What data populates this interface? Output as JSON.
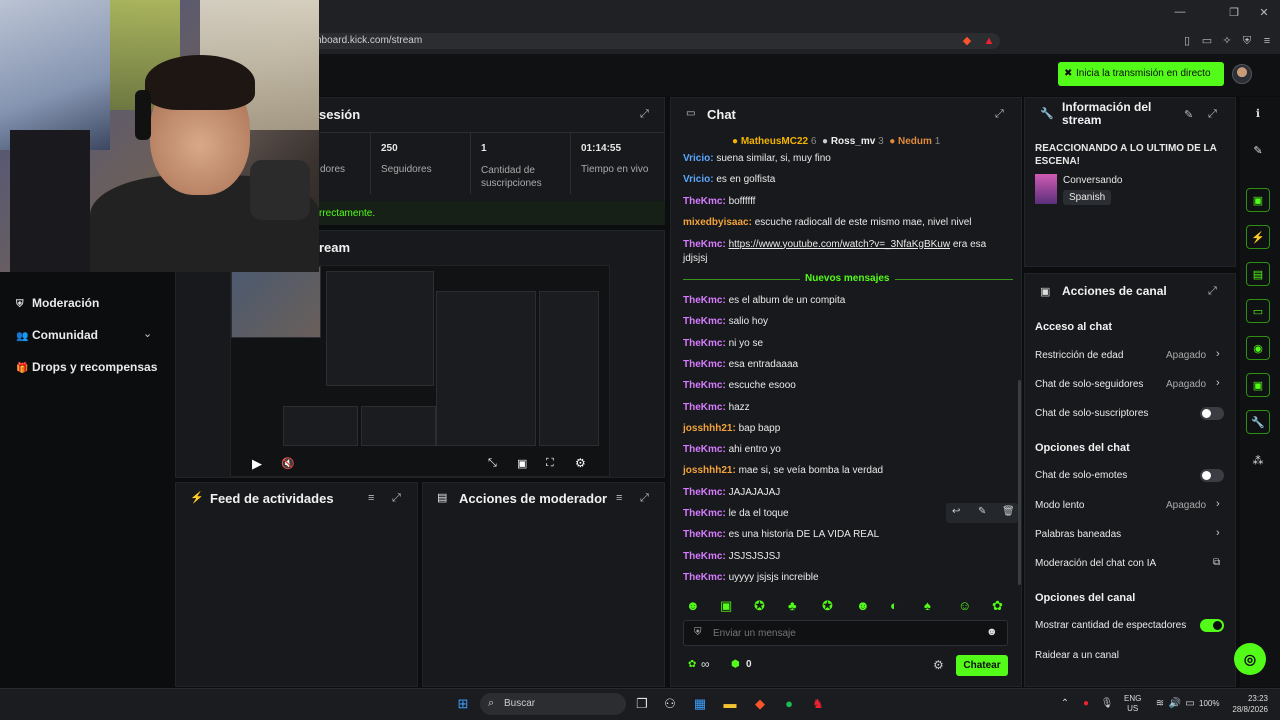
{
  "browser": {
    "url": "hboard.kick.com/stream",
    "window_controls": [
      "minimize-icon",
      "restore-icon",
      "close-icon"
    ]
  },
  "topbar": {
    "go_live_label": "Inicia la transmisión en directo"
  },
  "stats": {
    "title_fragment": "sesión",
    "items": [
      {
        "value": "",
        "label": "dores"
      },
      {
        "value": "250",
        "label": "Seguidores"
      },
      {
        "value": "1",
        "label": "Cantidad de suscripciones"
      },
      {
        "value": "01:14:55",
        "label": "Tiempo en vivo"
      }
    ],
    "status_text": "rrectamente."
  },
  "stream_section": {
    "title_fragment": "ream"
  },
  "sidebar": {
    "items": [
      {
        "label": "Moderación"
      },
      {
        "label": "Comunidad"
      },
      {
        "label": "Drops y recompensas"
      }
    ]
  },
  "feed": {
    "title": "Feed de actividades"
  },
  "modactions": {
    "title": "Acciones de moderador"
  },
  "chat": {
    "title": "Chat",
    "leaders": [
      {
        "name": "MatheusMC22",
        "count": "6"
      },
      {
        "name": "Ross_mv",
        "count": "3"
      },
      {
        "name": "Nedum",
        "count": "1"
      }
    ],
    "messages_before": [
      {
        "user": "Vricio",
        "text": "suena similar, si, muy fino",
        "color": "blue"
      },
      {
        "user": "Vricio",
        "text": "es en golfista",
        "color": "blue"
      },
      {
        "user": "TheKmc",
        "text": "boffffff",
        "color": "pink"
      },
      {
        "user": "mixedbyisaac",
        "text": "escuche radiocall de este mismo mae, nivel nivel",
        "color": "orange"
      },
      {
        "user": "TheKmc",
        "text": "https://www.youtube.com/watch?v=_3NfaKgBKuw",
        "text2": "era esa",
        "text3": "jdjsjsj",
        "color": "pink"
      }
    ],
    "new_divider": "Nuevos mensajes",
    "messages_after": [
      {
        "user": "TheKmc",
        "text": "es el album de un compita",
        "color": "pink"
      },
      {
        "user": "TheKmc",
        "text": "salio hoy",
        "color": "pink"
      },
      {
        "user": "TheKmc",
        "text": "ni yo se",
        "color": "pink"
      },
      {
        "user": "TheKmc",
        "text": "esa entradaaaa",
        "color": "pink"
      },
      {
        "user": "TheKmc",
        "text": "escuche esooo",
        "color": "pink"
      },
      {
        "user": "TheKmc",
        "text": "hazz",
        "color": "pink"
      },
      {
        "user": "josshhh21",
        "text": "bap bapp",
        "color": "orange"
      },
      {
        "user": "TheKmc",
        "text": "ahi entro yo",
        "color": "pink"
      },
      {
        "user": "josshhh21",
        "text": "mae si, se veía bomba la verdad",
        "color": "orange"
      },
      {
        "user": "TheKmc",
        "text": "JAJAJAJAJ",
        "color": "pink"
      },
      {
        "user": "TheKmc",
        "text": "le da el toque",
        "color": "pink"
      },
      {
        "user": "TheKmc",
        "text": "es una historia DE LA VIDA REAL",
        "color": "pink"
      },
      {
        "user": "TheKmc",
        "text": "JSJSJSJSJ",
        "color": "pink"
      },
      {
        "user": "TheKmc",
        "text": "uyyyy jsjsjs increible",
        "color": "pink"
      }
    ],
    "input_placeholder": "Enviar un mensaje",
    "infinite_label": "∞",
    "points_value": "0",
    "send_label": "Chatear"
  },
  "info": {
    "title": "Información del stream",
    "stream_title": "REACCIONANDO A LO ULTIMO DE LA ESCENA!",
    "category": "Conversando",
    "language": "Spanish"
  },
  "channel_actions": {
    "title": "Acciones de canal",
    "chat_access_title": "Acceso al chat",
    "age_restriction": {
      "label": "Restricción de edad",
      "value": "Apagado"
    },
    "followers_only": {
      "label": "Chat de solo-seguidores",
      "value": "Apagado"
    },
    "subscribers_only": {
      "label": "Chat de solo-suscriptores",
      "on": false
    },
    "chat_options_title": "Opciones del chat",
    "emotes_only": {
      "label": "Chat de solo-emotes",
      "on": false
    },
    "slow_mode": {
      "label": "Modo lento",
      "value": "Apagado"
    },
    "banned_words": {
      "label": "Palabras baneadas"
    },
    "ai_moderation": {
      "label": "Moderación del chat con IA"
    },
    "channel_options_title": "Opciones del canal",
    "show_viewers": {
      "label": "Mostrar cantidad de espectadores",
      "on": true
    },
    "raid": {
      "label": "Raidear a un canal"
    }
  },
  "taskbar": {
    "search_placeholder": "Buscar",
    "lang_line1": "ENG",
    "lang_line2": "US",
    "battery": "100%",
    "time": "23:23",
    "date": "28/8/2026"
  },
  "colors": {
    "accent": "#53fc18",
    "background": "#0b0d0f",
    "panel": "#17191c"
  }
}
